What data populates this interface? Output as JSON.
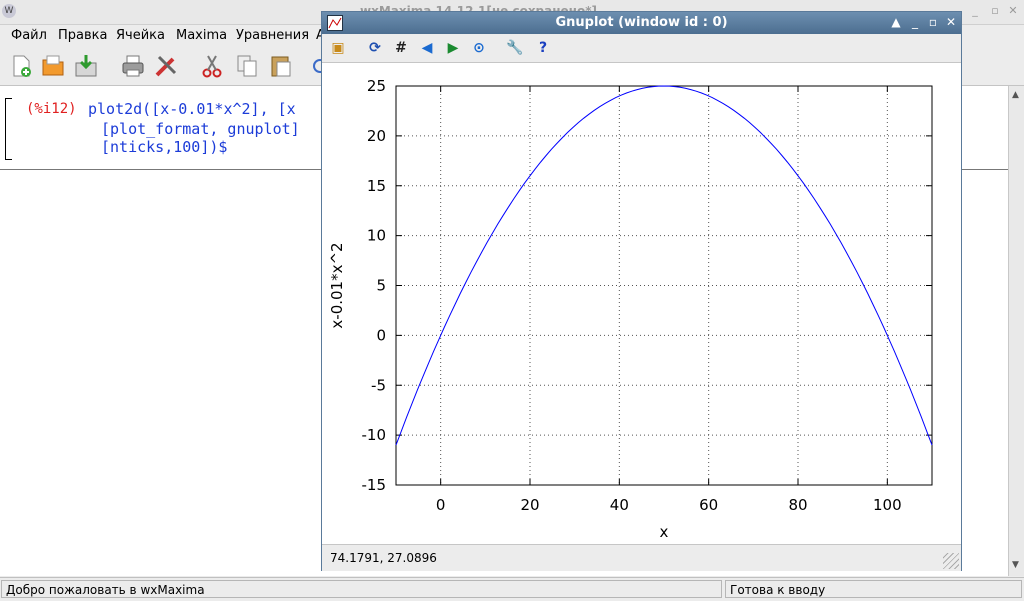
{
  "wxmaxima": {
    "title": "wxMaxima 14.12.1[не сохранено*]",
    "menu": [
      "Файл",
      "Правка",
      "Ячейка",
      "Maxima",
      "Уравнения",
      "А"
    ],
    "cell": {
      "label": "(%i12)",
      "lines": [
        "plot2d([x-0.01*x^2], [x",
        "[plot_format, gnuplot]",
        "[nticks,100])$"
      ]
    },
    "status_left": "Добро пожаловать в wxMaxima",
    "status_right": "Готова к вводу",
    "toolbar_icons": [
      "new-document-icon",
      "open-folder-icon",
      "save-icon",
      "print-icon",
      "preferences-icon",
      "cut-icon",
      "copy-icon",
      "paste-icon"
    ]
  },
  "gnuplot": {
    "title": "Gnuplot (window id : 0)",
    "coords": "74.1791, 27.0896",
    "toolbar_icons": [
      "copy-to-clipboard-icon",
      "replot-icon",
      "grid-icon",
      "zoom-previous-icon",
      "zoom-next-icon",
      "autoscale-icon",
      "config-icon",
      "help-icon"
    ]
  },
  "chart_data": {
    "type": "line",
    "expression": "x-0.01*x^2",
    "x_range": [
      -10,
      110
    ],
    "y_range": [
      -15,
      25
    ],
    "x_ticks": [
      0,
      20,
      40,
      60,
      80,
      100
    ],
    "y_ticks": [
      -15,
      -10,
      -5,
      0,
      5,
      10,
      15,
      20,
      25
    ],
    "xlabel": "x",
    "ylabel": "x-0.01*x^2",
    "grid": true,
    "series": [
      {
        "color": "#0000ff",
        "samples": 100
      }
    ]
  }
}
